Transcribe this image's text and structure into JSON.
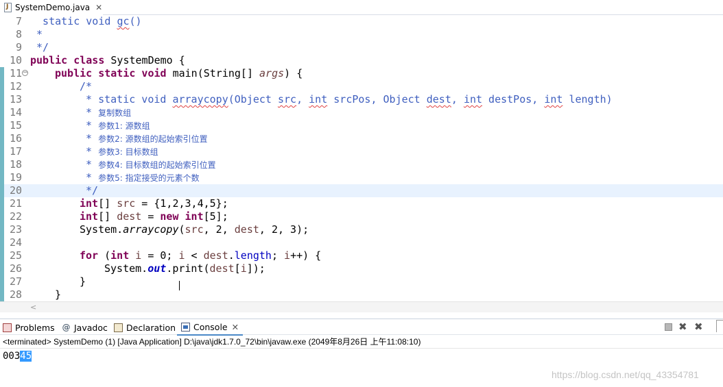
{
  "editor": {
    "tab_label": "SystemDemo.java",
    "tab_close": "✕",
    "lines": [
      {
        "n": "7"
      },
      {
        "n": "8"
      },
      {
        "n": "9"
      },
      {
        "n": "10"
      },
      {
        "n": "11"
      },
      {
        "n": "12"
      },
      {
        "n": "13"
      },
      {
        "n": "14"
      },
      {
        "n": "15"
      },
      {
        "n": "16"
      },
      {
        "n": "17"
      },
      {
        "n": "18"
      },
      {
        "n": "19"
      },
      {
        "n": "20"
      },
      {
        "n": "21"
      },
      {
        "n": "22"
      },
      {
        "n": "23"
      },
      {
        "n": "24"
      },
      {
        "n": "25"
      },
      {
        "n": "26"
      },
      {
        "n": "27"
      },
      {
        "n": "28"
      }
    ],
    "code": {
      "l7_a": "  static void ",
      "l7_b": "gc",
      "l7_c": "()",
      "l8": " *",
      "l9": " */",
      "l10_kw": "public class",
      "l10_rest": " SystemDemo {",
      "l11_kw": "public static void",
      "l11_rest": " main(String[] ",
      "l11_var": "args",
      "l11_end": ") {",
      "l12": "/*",
      "l13_a": " * static void ",
      "l13_b": "arraycopy",
      "l13_c": "(Object ",
      "l13_d": "src",
      "l13_e": ", ",
      "l13_f": "int",
      "l13_g": " srcPos, Object ",
      "l13_h": "dest",
      "l13_i": ", ",
      "l13_j": "int",
      "l13_k": " destPos, ",
      "l13_l": "int",
      "l13_m": " length)",
      "l14_star": " * ",
      "l14_text": "复制数组",
      "l15_star": " * ",
      "l15_text": "参数1: 源数组",
      "l16_star": " * ",
      "l16_text": "参数2: 源数组的起始索引位置",
      "l17_star": " * ",
      "l17_text": "参数3: 目标数组",
      "l18_star": " * ",
      "l18_text": "参数4: 目标数组的起始索引位置",
      "l19_star": " * ",
      "l19_text": "参数5: 指定接受的元素个数",
      "l20": " */",
      "l21_kw": "int",
      "l21_a": "[] ",
      "l21_var": "src",
      "l21_b": " = {1,2,3,4,5};",
      "l22_kw": "int",
      "l22_a": "[] ",
      "l22_var": "dest",
      "l22_b": " = ",
      "l22_kw2": "new",
      "l22_c": " ",
      "l22_kw3": "int",
      "l22_d": "[5];",
      "l23_a": "System.",
      "l23_it": "arraycopy",
      "l23_b": "(",
      "l23_var1": "src",
      "l23_c": ", 2, ",
      "l23_var2": "dest",
      "l23_d": ", 2, 3);",
      "l25_kw": "for",
      "l25_a": " (",
      "l25_kw2": "int",
      "l25_b": " ",
      "l25_var1": "i",
      "l25_c": " = 0; ",
      "l25_var2": "i",
      "l25_d": " < ",
      "l25_var3": "dest",
      "l25_e": ".",
      "l25_fld": "length",
      "l25_f": "; ",
      "l25_var4": "i",
      "l25_g": "++) {",
      "l26_a": "System.",
      "l26_fld": "out",
      "l26_b": ".print(",
      "l26_var1": "dest",
      "l26_c": "[",
      "l26_var2": "i",
      "l26_d": "]);",
      "l27": "}",
      "l28": "}"
    },
    "hscroll_arrow": "<"
  },
  "panel": {
    "tabs": [
      {
        "label": "Problems"
      },
      {
        "label": "Javadoc",
        "icon_text": "@"
      },
      {
        "label": "Declaration"
      },
      {
        "label": "Console",
        "close": "✕"
      }
    ],
    "tool_remove": "✖",
    "tool_remove_all": "✖"
  },
  "console": {
    "status": "<terminated> SystemDemo (1) [Java Application] D:\\java\\jdk1.7.0_72\\bin\\javaw.exe (2049年8月26日 上午11:08:10)",
    "output_plain": "003",
    "output_selected": "45"
  },
  "watermark": "https://blog.csdn.net/qq_43354781",
  "colors": {
    "keyword": "#7f0055",
    "comment": "#3f5fbf",
    "local_variable": "#6a3e3e",
    "static_field": "#0000c0",
    "current_line": "#e8f2fe",
    "change_bar": "#73b8c4",
    "selection": "#3399ff"
  }
}
